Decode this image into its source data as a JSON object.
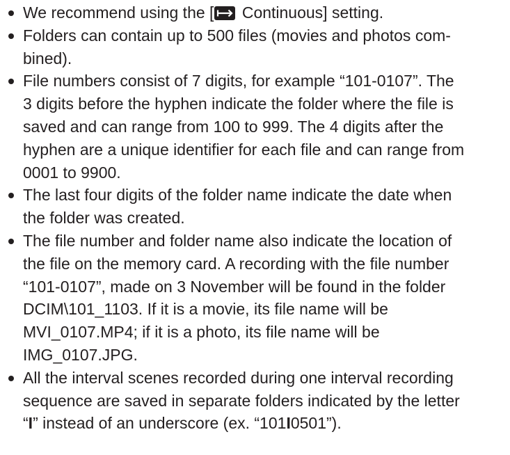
{
  "items": [
    {
      "lines": [
        {
          "pre": "We recommend using the [",
          "icon": "continuous-arrow-icon",
          "post": " Continuous] setting."
        }
      ]
    },
    {
      "lines": [
        "Folders can contain up to 500 files (movies and photos com-",
        "bined)."
      ]
    },
    {
      "lines": [
        "File numbers consist of 7 digits, for example “101-0107”. The",
        "3 digits before the hyphen indicate the folder where the file is",
        "saved and can range from 100 to 999. The 4 digits after the",
        "hyphen are a unique identifier for each file and can range from",
        "0001 to 9900."
      ]
    },
    {
      "lines": [
        "The last four digits of the folder name indicate the date when",
        "the folder was created."
      ]
    },
    {
      "lines": [
        "The file number and folder name also indicate the location of",
        "the file on the memory card. A recording with the file number",
        "“101-0107”, made on 3 November will be found in the folder",
        "DCIM\\101_1103. If it is a movie, its file name will be",
        "MVI_0107.MP4; if it is a photo, its file name will be",
        "IMG_0107.JPG."
      ]
    },
    {
      "lines": [
        "All the interval scenes recorded during one interval recording",
        "sequence are saved in separate folders indicated by the letter",
        {
          "pre": "“",
          "bold": "I",
          "mid": "” instead of an underscore (ex. “101",
          "bold2": "I",
          "post": "0501”)."
        }
      ]
    }
  ]
}
